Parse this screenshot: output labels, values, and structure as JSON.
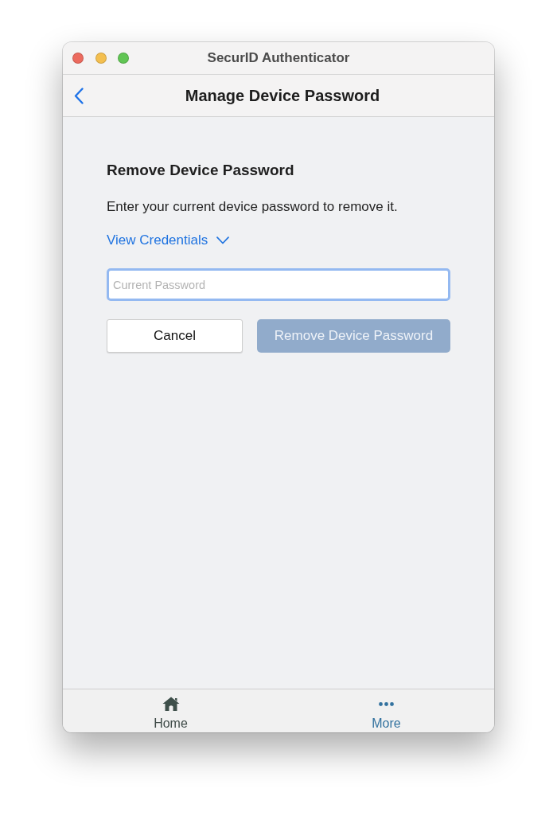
{
  "window": {
    "title": "SecurID Authenticator"
  },
  "nav_bar": {
    "title": "Manage Device Password"
  },
  "section": {
    "heading": "Remove Device Password",
    "description": "Enter your current device password to remove it.",
    "disclosure": {
      "label": "View Credentials",
      "expanded": false
    },
    "password_field": {
      "placeholder": "Current Password",
      "focused": true
    },
    "buttons": [
      {
        "label": "Cancel",
        "kind": "secondary",
        "disabled": false
      },
      {
        "label": "Remove Device Password",
        "kind": "primary",
        "disabled": true
      }
    ]
  },
  "tab_bar": {
    "items": [
      {
        "label": "Home",
        "kind": "home",
        "selected": false
      },
      {
        "label": "More",
        "kind": "more",
        "selected": true
      }
    ]
  }
}
